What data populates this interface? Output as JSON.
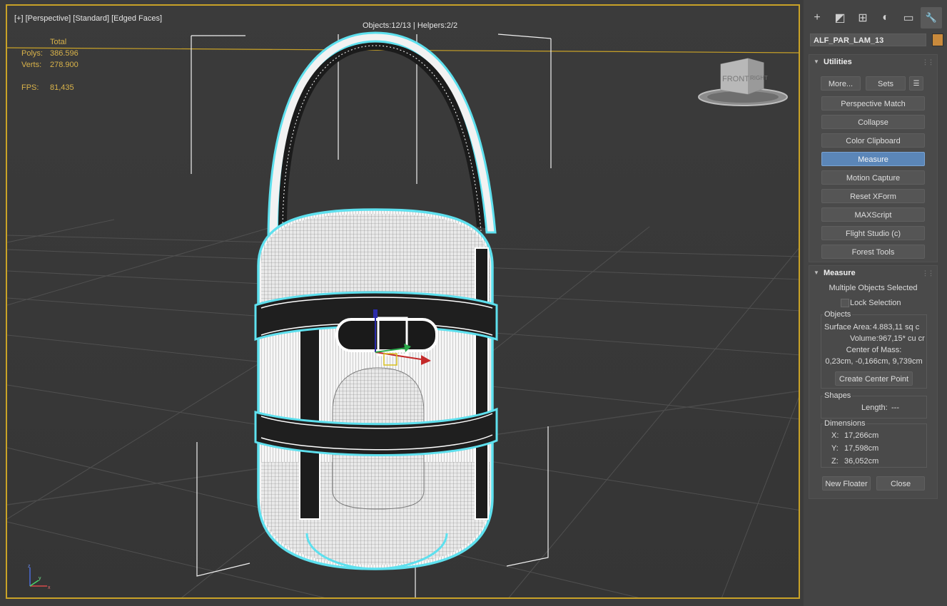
{
  "viewport": {
    "label": {
      "plus": "[+]",
      "view": "[Perspective]",
      "shading": "[Standard]",
      "style": "[Edged Faces]"
    },
    "object_counter": "Objects:12/13 | Helpers:2/2",
    "stats": {
      "header": "Total",
      "polys_label": "Polys:",
      "polys_value": "386.596",
      "verts_label": "Verts:",
      "verts_value": "278.900",
      "fps_label": "FPS:",
      "fps_value": "81,435"
    },
    "viewcube": {
      "front_label": "FRONT",
      "right_label": "RIGHT"
    },
    "axis_tripod_labels": {
      "x": "x",
      "y": "y",
      "z": "z"
    },
    "colors": {
      "active_border": "#c9a227",
      "selection_wire": "#5ee0ee",
      "grid": "#505050"
    }
  },
  "command_panel": {
    "tabs": [
      {
        "icon": "plus-icon",
        "glyph": "+"
      },
      {
        "icon": "modify-icon",
        "glyph": "◩"
      },
      {
        "icon": "hierarchy-icon",
        "glyph": "⊞"
      },
      {
        "icon": "motion-icon",
        "glyph": "◐"
      },
      {
        "icon": "display-icon",
        "glyph": "▭"
      },
      {
        "icon": "utilities-icon",
        "glyph": "🔧"
      }
    ],
    "object_name": "ALF_PAR_LAM_13",
    "object_color": "#c98a3c",
    "utilities": {
      "title": "Utilities",
      "more_label": "More...",
      "sets_label": "Sets",
      "buttons": [
        "Perspective Match",
        "Collapse",
        "Color Clipboard",
        "Measure",
        "Motion Capture",
        "Reset XForm",
        "MAXScript",
        "Flight Studio (c)",
        "Forest Tools"
      ],
      "active_button": "Measure"
    },
    "measure": {
      "title": "Measure",
      "selection_text": "Multiple Objects Selected",
      "lock_selection_label": "Lock Selection",
      "objects": {
        "title": "Objects",
        "surface_area_label": "Surface Area:",
        "surface_area_value": "4.883,11 sq c",
        "volume_label": "Volume:",
        "volume_value": "967,15* cu cr",
        "center_of_mass_label": "Center of Mass:",
        "center_of_mass_value": "0,23cm, -0,166cm, 9,739cm",
        "create_center_point_label": "Create Center Point"
      },
      "shapes": {
        "title": "Shapes",
        "length_label": "Length:",
        "length_value": "---"
      },
      "dimensions": {
        "title": "Dimensions",
        "x_label": "X:",
        "x_value": "17,266cm",
        "y_label": "Y:",
        "y_value": "17,598cm",
        "z_label": "Z:",
        "z_value": "36,052cm"
      },
      "new_floater_label": "New Floater",
      "close_label": "Close"
    }
  }
}
